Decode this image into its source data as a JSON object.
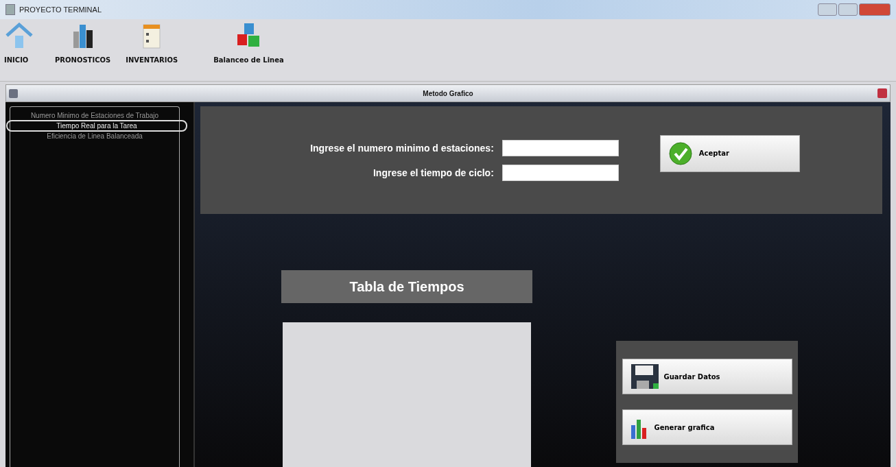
{
  "window": {
    "title": "PROYECTO TERMINAL"
  },
  "toolbar": [
    {
      "label": "INICIO",
      "kind": "home"
    },
    {
      "label": "PRONOSTICOS",
      "kind": "bars"
    },
    {
      "label": "INVENTARIOS",
      "kind": "clipboard"
    },
    {
      "label": "Balanceo de Linea",
      "kind": "cubes"
    }
  ],
  "internal_frame": {
    "title": "Metodo Grafico"
  },
  "sidebar": {
    "items": [
      {
        "label": "Numero Minimo de Estaciones de Trabajo",
        "selected": false
      },
      {
        "label": "Tiempo Real para la Tarea",
        "selected": true
      },
      {
        "label": "Eficiencia de Linea Balanceada",
        "selected": false
      }
    ]
  },
  "form": {
    "fields": [
      {
        "label": "Ingrese el numero minimo d estaciones:"
      },
      {
        "label": "Ingrese el tiempo de ciclo:"
      }
    ],
    "accept_button": "Aceptar"
  },
  "table": {
    "title": "Tabla de Tiempos"
  },
  "actions": [
    {
      "label": "Guardar Datos",
      "kind": "save"
    },
    {
      "label": "Generar grafica",
      "kind": "chart"
    }
  ]
}
